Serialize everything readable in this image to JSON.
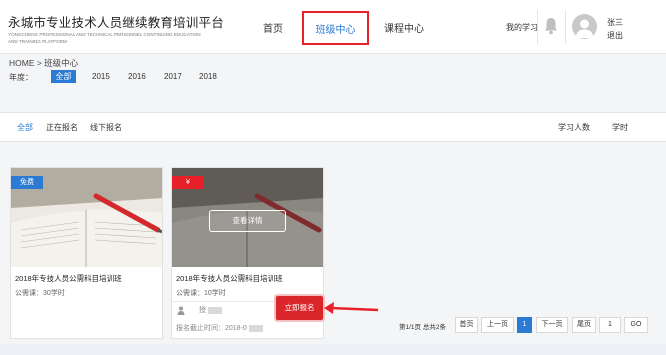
{
  "header": {
    "logo_title": "永城市专业技术人员继续教育培训平台",
    "logo_sub_1": "YONGCHENG PROFESSIONAL AND TECHNICAL PERSONNEL CONTINUING EDUCATION",
    "logo_sub_2": "AND TRAINING PLATFORM",
    "nav": [
      "首页",
      "班级中心",
      "课程中心"
    ],
    "active_nav": "班级中心",
    "my_study": "我的学习",
    "user_name": "张三",
    "logout": "退出"
  },
  "breadcrumb": "HOME  >  班级中心",
  "year_filter": {
    "label": "年度：",
    "all": "全部",
    "years": [
      "2015",
      "2016",
      "2017",
      "2018"
    ]
  },
  "filter_bar": {
    "tabs": [
      "全部",
      "正在报名",
      "线下报名"
    ],
    "sort": [
      "学习人数",
      "学时"
    ]
  },
  "cards": [
    {
      "badge": "免费",
      "title": "2018年专技人员公需科目培训班",
      "meta": "公需课：30学时"
    },
    {
      "badge": "¥",
      "detail_button": "查看详情",
      "title": "2018年专技人员公需科目培训班",
      "meta": "公需课：10学时",
      "teacher": "授",
      "deadline": "报名截止时间：2018-0",
      "signup_button": "立即报名"
    }
  ],
  "pagination": {
    "info": "第1/1页 总共2条",
    "first": "首页",
    "prev": "上一页",
    "current": "1",
    "next": "下一页",
    "last": "尾页",
    "page_input": "1",
    "go": "GO"
  },
  "colors": {
    "accent_blue": "#2b7ad4",
    "highlight_red": "#e8202a",
    "signup_red": "#d9262b"
  }
}
